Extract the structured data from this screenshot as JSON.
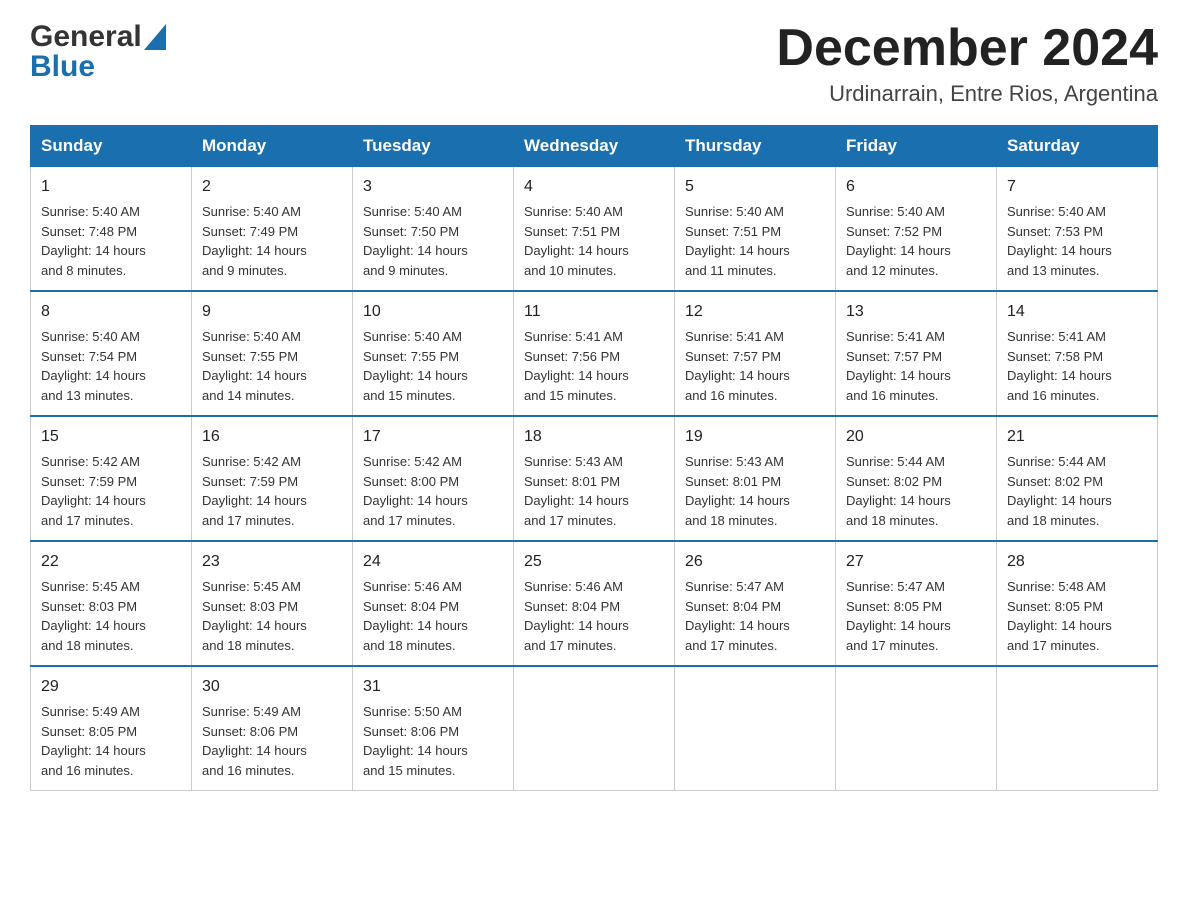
{
  "header": {
    "logo_general": "General",
    "logo_blue": "Blue",
    "title": "December 2024",
    "subtitle": "Urdinarrain, Entre Rios, Argentina"
  },
  "days_of_week": [
    "Sunday",
    "Monday",
    "Tuesday",
    "Wednesday",
    "Thursday",
    "Friday",
    "Saturday"
  ],
  "weeks": [
    [
      {
        "day": "1",
        "sunrise": "5:40 AM",
        "sunset": "7:48 PM",
        "daylight": "14 hours and 8 minutes."
      },
      {
        "day": "2",
        "sunrise": "5:40 AM",
        "sunset": "7:49 PM",
        "daylight": "14 hours and 9 minutes."
      },
      {
        "day": "3",
        "sunrise": "5:40 AM",
        "sunset": "7:50 PM",
        "daylight": "14 hours and 9 minutes."
      },
      {
        "day": "4",
        "sunrise": "5:40 AM",
        "sunset": "7:51 PM",
        "daylight": "14 hours and 10 minutes."
      },
      {
        "day": "5",
        "sunrise": "5:40 AM",
        "sunset": "7:51 PM",
        "daylight": "14 hours and 11 minutes."
      },
      {
        "day": "6",
        "sunrise": "5:40 AM",
        "sunset": "7:52 PM",
        "daylight": "14 hours and 12 minutes."
      },
      {
        "day": "7",
        "sunrise": "5:40 AM",
        "sunset": "7:53 PM",
        "daylight": "14 hours and 13 minutes."
      }
    ],
    [
      {
        "day": "8",
        "sunrise": "5:40 AM",
        "sunset": "7:54 PM",
        "daylight": "14 hours and 13 minutes."
      },
      {
        "day": "9",
        "sunrise": "5:40 AM",
        "sunset": "7:55 PM",
        "daylight": "14 hours and 14 minutes."
      },
      {
        "day": "10",
        "sunrise": "5:40 AM",
        "sunset": "7:55 PM",
        "daylight": "14 hours and 15 minutes."
      },
      {
        "day": "11",
        "sunrise": "5:41 AM",
        "sunset": "7:56 PM",
        "daylight": "14 hours and 15 minutes."
      },
      {
        "day": "12",
        "sunrise": "5:41 AM",
        "sunset": "7:57 PM",
        "daylight": "14 hours and 16 minutes."
      },
      {
        "day": "13",
        "sunrise": "5:41 AM",
        "sunset": "7:57 PM",
        "daylight": "14 hours and 16 minutes."
      },
      {
        "day": "14",
        "sunrise": "5:41 AM",
        "sunset": "7:58 PM",
        "daylight": "14 hours and 16 minutes."
      }
    ],
    [
      {
        "day": "15",
        "sunrise": "5:42 AM",
        "sunset": "7:59 PM",
        "daylight": "14 hours and 17 minutes."
      },
      {
        "day": "16",
        "sunrise": "5:42 AM",
        "sunset": "7:59 PM",
        "daylight": "14 hours and 17 minutes."
      },
      {
        "day": "17",
        "sunrise": "5:42 AM",
        "sunset": "8:00 PM",
        "daylight": "14 hours and 17 minutes."
      },
      {
        "day": "18",
        "sunrise": "5:43 AM",
        "sunset": "8:01 PM",
        "daylight": "14 hours and 17 minutes."
      },
      {
        "day": "19",
        "sunrise": "5:43 AM",
        "sunset": "8:01 PM",
        "daylight": "14 hours and 18 minutes."
      },
      {
        "day": "20",
        "sunrise": "5:44 AM",
        "sunset": "8:02 PM",
        "daylight": "14 hours and 18 minutes."
      },
      {
        "day": "21",
        "sunrise": "5:44 AM",
        "sunset": "8:02 PM",
        "daylight": "14 hours and 18 minutes."
      }
    ],
    [
      {
        "day": "22",
        "sunrise": "5:45 AM",
        "sunset": "8:03 PM",
        "daylight": "14 hours and 18 minutes."
      },
      {
        "day": "23",
        "sunrise": "5:45 AM",
        "sunset": "8:03 PM",
        "daylight": "14 hours and 18 minutes."
      },
      {
        "day": "24",
        "sunrise": "5:46 AM",
        "sunset": "8:04 PM",
        "daylight": "14 hours and 18 minutes."
      },
      {
        "day": "25",
        "sunrise": "5:46 AM",
        "sunset": "8:04 PM",
        "daylight": "14 hours and 17 minutes."
      },
      {
        "day": "26",
        "sunrise": "5:47 AM",
        "sunset": "8:04 PM",
        "daylight": "14 hours and 17 minutes."
      },
      {
        "day": "27",
        "sunrise": "5:47 AM",
        "sunset": "8:05 PM",
        "daylight": "14 hours and 17 minutes."
      },
      {
        "day": "28",
        "sunrise": "5:48 AM",
        "sunset": "8:05 PM",
        "daylight": "14 hours and 17 minutes."
      }
    ],
    [
      {
        "day": "29",
        "sunrise": "5:49 AM",
        "sunset": "8:05 PM",
        "daylight": "14 hours and 16 minutes."
      },
      {
        "day": "30",
        "sunrise": "5:49 AM",
        "sunset": "8:06 PM",
        "daylight": "14 hours and 16 minutes."
      },
      {
        "day": "31",
        "sunrise": "5:50 AM",
        "sunset": "8:06 PM",
        "daylight": "14 hours and 15 minutes."
      },
      null,
      null,
      null,
      null
    ]
  ],
  "labels": {
    "sunrise": "Sunrise:",
    "sunset": "Sunset:",
    "daylight": "Daylight:"
  }
}
